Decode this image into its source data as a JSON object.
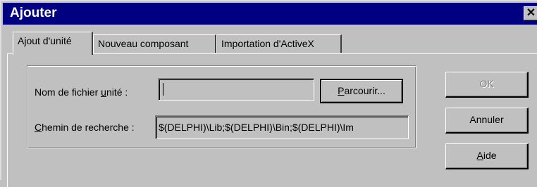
{
  "window": {
    "title": "Ajouter",
    "close_glyph": "✕"
  },
  "tabs": [
    {
      "label": "Ajout d'unité",
      "active": true
    },
    {
      "label": "Nouveau composant",
      "active": false
    },
    {
      "label": "Importation d'ActiveX",
      "active": false
    }
  ],
  "form": {
    "filename_label_pre": "Nom de fichier ",
    "filename_label_mnemonic": "u",
    "filename_label_post": "nité :",
    "filename_value": "",
    "browse_mnemonic": "P",
    "browse_rest": "arcourir...",
    "search_path_mnemonic": "C",
    "search_path_rest": "hemin de recherche :",
    "search_path_value": "$(DELPHI)\\Lib;$(DELPHI)\\Bin;$(DELPHI)\\Im"
  },
  "buttons": {
    "ok_label": "OK",
    "ok_enabled": false,
    "cancel_label": "Annuler",
    "help_mnemonic": "A",
    "help_rest": "ide"
  },
  "colors": {
    "titlebar": "#000080",
    "face": "#c0c0c0"
  },
  "icons": {
    "close": "close-icon"
  }
}
